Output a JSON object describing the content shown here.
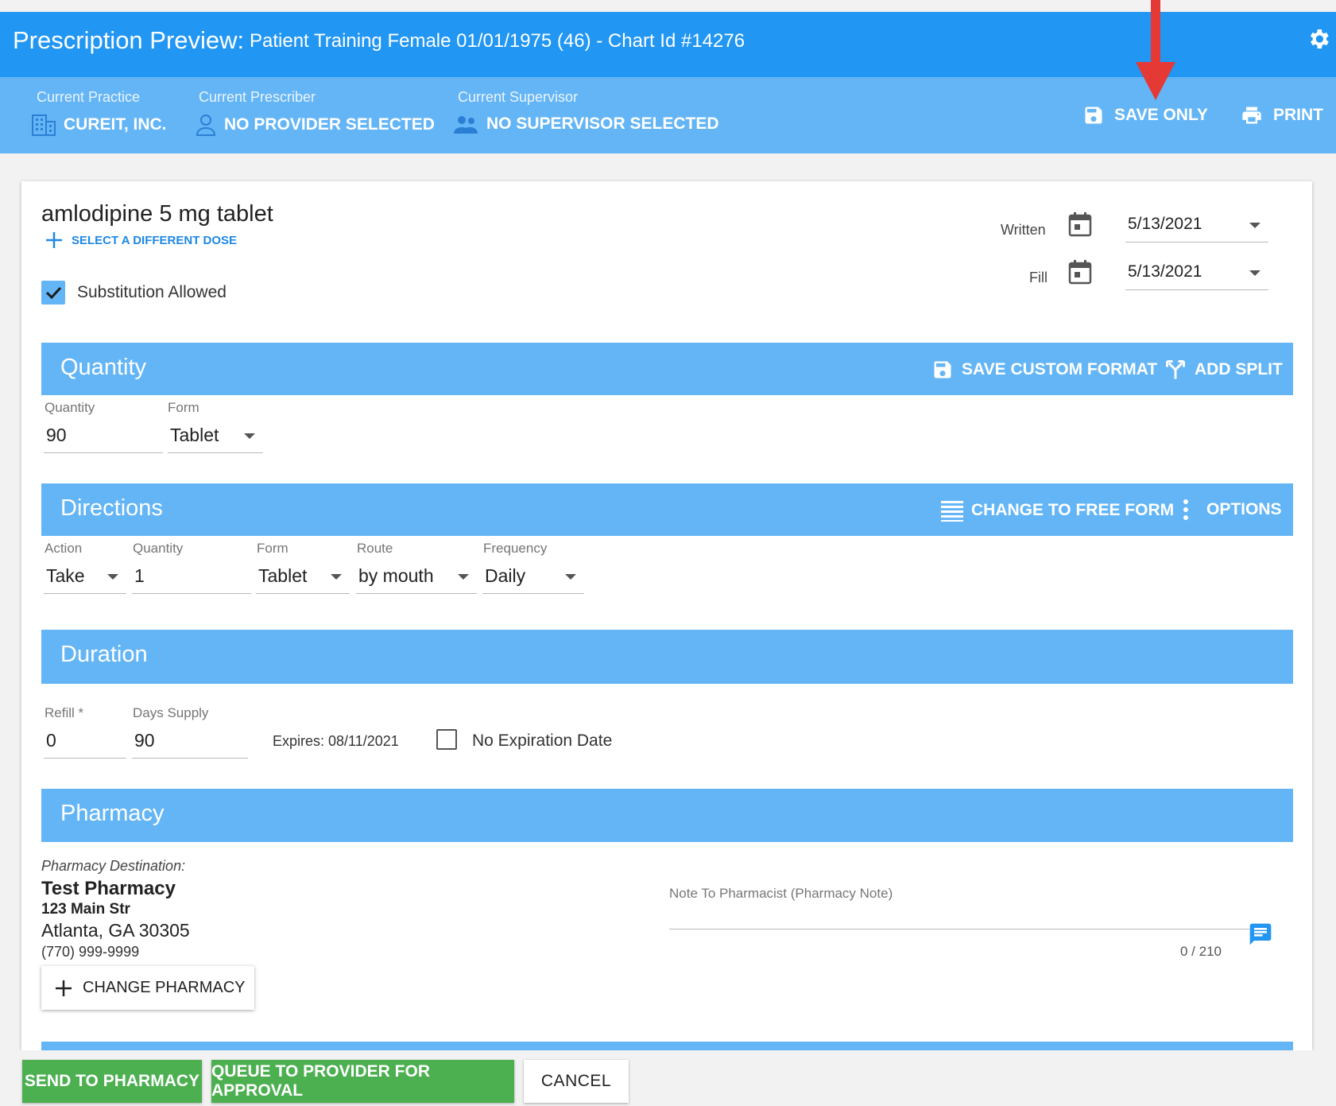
{
  "header": {
    "title": "Prescription Preview:",
    "patient": "Patient Training Female 01/01/1975 (46) - Chart Id #14276",
    "icon": "gear-icon"
  },
  "subheader": {
    "practice_label": "Current Practice",
    "practice_value": "CUREIT, INC.",
    "prescriber_label": "Current Prescriber",
    "prescriber_value": "NO PROVIDER SELECTED",
    "supervisor_label": "Current Supervisor",
    "supervisor_value": "NO SUPERVISOR SELECTED",
    "save_only": "SAVE ONLY",
    "print": "PRINT"
  },
  "drug": {
    "name": "amlodipine 5 mg tablet",
    "select_dose": "SELECT A DIFFERENT DOSE",
    "substitution_label": "Substitution Allowed",
    "substitution_checked": true,
    "written_label": "Written",
    "written_date": "5/13/2021",
    "fill_label": "Fill",
    "fill_date": "5/13/2021"
  },
  "quantity": {
    "title": "Quantity",
    "save_custom": "SAVE CUSTOM FORMAT",
    "add_split": "ADD SPLIT",
    "quantity_label": "Quantity",
    "quantity_value": "90",
    "form_label": "Form",
    "form_value": "Tablet"
  },
  "directions": {
    "title": "Directions",
    "free_form": "CHANGE TO FREE FORM",
    "options": "OPTIONS",
    "action_label": "Action",
    "action_value": "Take",
    "quantity_label": "Quantity",
    "quantity_value": "1",
    "form_label": "Form",
    "form_value": "Tablet",
    "route_label": "Route",
    "route_value": "by mouth",
    "frequency_label": "Frequency",
    "frequency_value": "Daily"
  },
  "duration": {
    "title": "Duration",
    "refill_label": "Refill *",
    "refill_value": "0",
    "days_label": "Days Supply",
    "days_value": "90",
    "expires": "Expires: 08/11/2021",
    "no_expiration": "No Expiration Date"
  },
  "pharmacy": {
    "title": "Pharmacy",
    "destination_label": "Pharmacy Destination:",
    "name": "Test Pharmacy",
    "street": "123 Main Str",
    "city": "Atlanta, GA 30305",
    "phone": "(770) 999-9999",
    "change_button": "CHANGE PHARMACY",
    "note_label": "Note To Pharmacist (Pharmacy Note)",
    "note_counter": "0 / 210"
  },
  "footer": {
    "send": "SEND TO PHARMACY",
    "queue": "QUEUE TO PROVIDER FOR APPROVAL",
    "cancel": "CANCEL"
  },
  "colors": {
    "primary": "#2196f3",
    "secondary": "#64b5f6",
    "success": "#4caf50",
    "annotation_arrow": "#e53935"
  }
}
